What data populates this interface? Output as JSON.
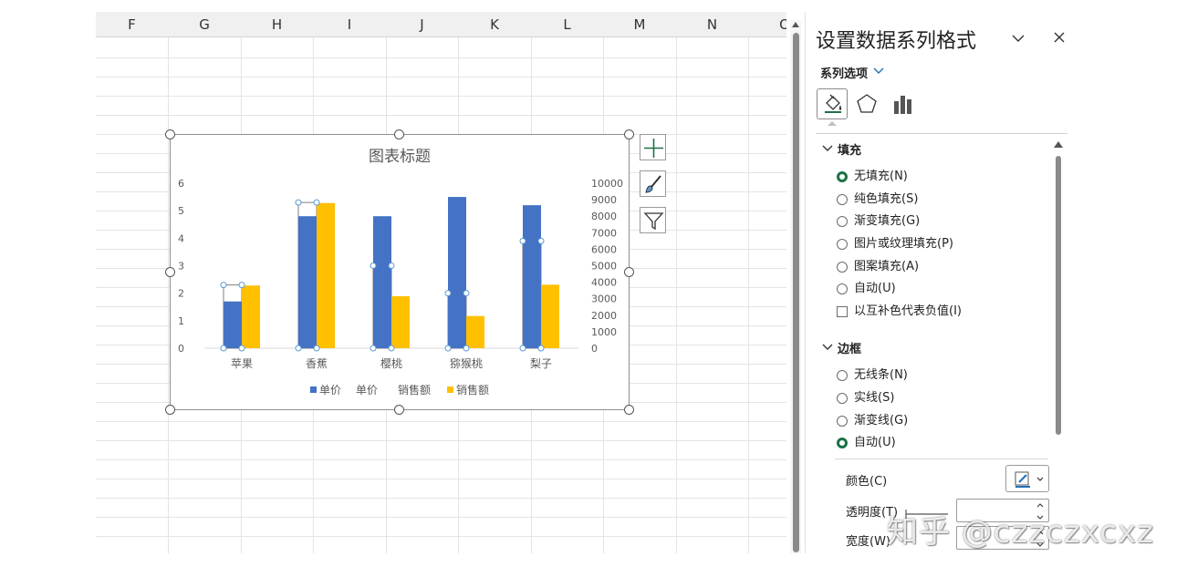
{
  "sheet": {
    "columns": [
      "F",
      "G",
      "H",
      "I",
      "J",
      "K",
      "L",
      "M",
      "N",
      "O"
    ]
  },
  "chart": {
    "title": "图表标题",
    "legend": [
      "单价",
      "单价",
      "销售额",
      "销售额"
    ]
  },
  "chart_data": {
    "type": "bar",
    "title": "图表标题",
    "categories": [
      "苹果",
      "香蕉",
      "樱桃",
      "猕猴桃",
      "梨子"
    ],
    "series": [
      {
        "name": "单价",
        "axis": "primary",
        "color": "#4472c4",
        "values": [
          1.7,
          4.8,
          4.8,
          5.5,
          5.2
        ]
      },
      {
        "name": "单价",
        "axis": "primary",
        "color": "#ffffff",
        "outline": "#7f7f7f",
        "selected": true,
        "values": [
          2.3,
          5.3,
          3.0,
          2.0,
          3.9
        ]
      },
      {
        "name": "销售额",
        "axis": "secondary",
        "color": "#ffc000",
        "values": [
          3800,
          8800,
          3150,
          1950,
          3850
        ]
      }
    ],
    "y_primary": {
      "ticks": [
        "0",
        "1",
        "2",
        "3",
        "4",
        "5",
        "6"
      ],
      "ylim": [
        0,
        6
      ]
    },
    "y_secondary": {
      "ticks": [
        "0",
        "1000",
        "2000",
        "3000",
        "4000",
        "5000",
        "6000",
        "7000",
        "8000",
        "9000",
        "10000"
      ],
      "ylim": [
        0,
        10000
      ]
    },
    "legend_position": "bottom",
    "grid": false
  },
  "pane": {
    "title": "设置数据系列格式",
    "series_options": "系列选项",
    "fill": {
      "header": "填充",
      "options": [
        "无填充(N)",
        "纯色填充(S)",
        "渐变填充(G)",
        "图片或纹理填充(P)",
        "图案填充(A)",
        "自动(U)"
      ],
      "selected": "无填充(N)",
      "invert_label": "以互补色代表负值(I)"
    },
    "border": {
      "header": "边框",
      "options": [
        "无线条(N)",
        "实线(S)",
        "渐变线(G)",
        "自动(U)"
      ],
      "selected": "自动(U)",
      "color_label": "颜色(C)",
      "transparency_label": "透明度(T)",
      "width_label": "宽度(W)"
    }
  },
  "watermark": "知乎 @czzczxcxz",
  "colors": {
    "accent_green": "#1e7145",
    "series_blue": "#4472c4",
    "series_gold": "#ffc000"
  }
}
